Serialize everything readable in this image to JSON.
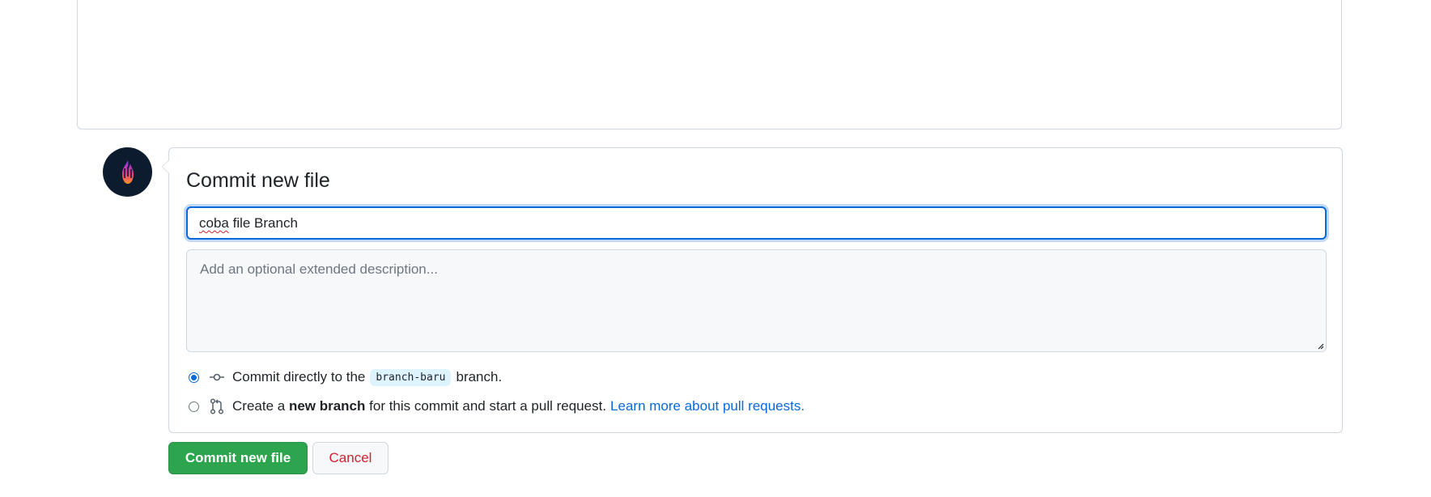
{
  "commit_form": {
    "title": "Commit new file",
    "summary_value_misspelled": "coba",
    "summary_value_rest": " file Branch",
    "description_placeholder": "Add an optional extended description...",
    "option_direct": {
      "prefix": "Commit directly to the",
      "branch_name": "branch-baru",
      "suffix": "branch.",
      "selected": true
    },
    "option_new_branch": {
      "prefix": "Create a",
      "bold": "new branch",
      "suffix": "for this commit and start a pull request.",
      "link": "Learn more about pull requests.",
      "selected": false
    }
  },
  "actions": {
    "commit_label": "Commit new file",
    "cancel_label": "Cancel"
  },
  "colors": {
    "accent": "#0969da",
    "commit_button": "#2da44e",
    "cancel_text": "#cf222e",
    "branch_tag_bg": "#ddf4ff"
  },
  "icons": {
    "avatar": "flame-avatar-icon",
    "direct_commit": "git-commit-icon",
    "new_branch": "git-pull-request-icon",
    "resize": "resize-handle-icon"
  }
}
